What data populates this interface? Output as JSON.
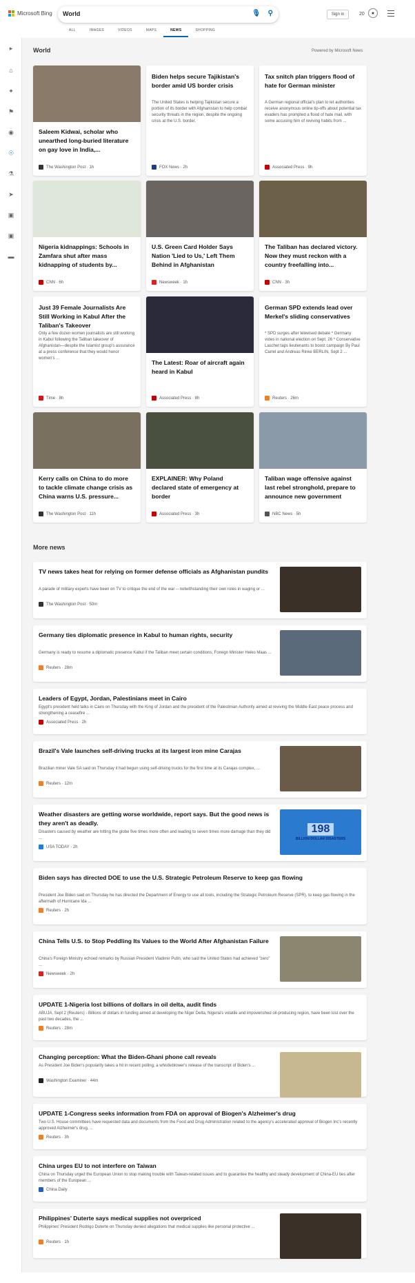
{
  "header": {
    "brand": "Microsoft Bing",
    "query": "World",
    "signin": "Sign in",
    "points": "20"
  },
  "tabs": [
    "ALL",
    "IMAGES",
    "VIDEOS",
    "MAPS",
    "NEWS",
    "SHOPPING"
  ],
  "section": {
    "title": "World",
    "powered": "Powered by Microsoft News"
  },
  "cards": [
    {
      "title": "Saleem Kidwai, scholar who unearthed long-buried literature on gay love in India,...",
      "snippet": "",
      "source": "The Washington Post · 1h",
      "img": true,
      "color": "#8a7a6a"
    },
    {
      "title": "Biden helps secure Tajikistan's border amid US border crisis",
      "snippet": "The United States is helping Tajikistan secure a portion of its border with Afghanistan to help combat security threats in the region, despite the ongoing crisis at the U.S. border.",
      "source": "FOX News · 2h",
      "img": false
    },
    {
      "title": "Tax snitch plan triggers flood of hate for German minister",
      "snippet": "A German regional official's plan to let authorities receive anonymous online tip-offs about potential tax evaders has prompted a flood of hate mail, with some accusing him of reviving habits from ...",
      "source": "Associated Press · 9h",
      "img": false
    },
    {
      "title": "Nigeria kidnappings: Schools in Zamfara shut after mass kidnapping of students by...",
      "snippet": "",
      "source": "CNN · 6h",
      "img": true,
      "color": "#dfe6da"
    },
    {
      "title": "U.S. Green Card Holder Says Nation 'Lied to Us,' Left Them Behind in Afghanistan",
      "snippet": "",
      "source": "Newsweek · 1h",
      "img": true,
      "color": "#6a6560"
    },
    {
      "title": "The Taliban has declared victory. Now they must reckon with a country freefalling into...",
      "snippet": "",
      "source": "CNN · 3h",
      "img": true,
      "color": "#6c6048"
    },
    {
      "title": "Just 39 Female Journalists Are Still Working in Kabul After the Taliban's Takeover",
      "snippet": "Only a few dozen women journalists are still working in Kabul following the Taliban takeover of Afghanistan—despite the Islamist group's assurance at a press conference that they would honor women's ...",
      "source": "Time · 8h",
      "img": false
    },
    {
      "title": "The Latest: Roar of aircraft again heard in Kabul",
      "snippet": "",
      "source": "Associated Press · 8h",
      "img": true,
      "color": "#2a2a3a"
    },
    {
      "title": "German SPD extends lead over Merkel's sliding conservatives",
      "snippet": "* SPD surges after televised debate * Germany votes in national election on Sept. 26 * Conservative Laschet taps lieutenants to boost campaign By Paul Carrel and Andreas Rinke BERLIN, Sept 2 ...",
      "source": "Reuters · 26m",
      "img": false
    },
    {
      "title": "Kerry calls on China to do more to tackle climate change crisis as China warns U.S. pressure...",
      "snippet": "",
      "source": "The Washington Post · 11h",
      "img": true,
      "color": "#7a7060"
    },
    {
      "title": "EXPLAINER: Why Poland declared state of emergency at border",
      "snippet": "",
      "source": "Associated Press · 3h",
      "img": true,
      "color": "#4a5040"
    },
    {
      "title": "Taliban wage offensive against last rebel stronghold, prepare to announce new government",
      "snippet": "",
      "source": "NBC News · 5h",
      "img": true,
      "color": "#8a9aa8"
    }
  ],
  "more_title": "More news",
  "more": [
    {
      "title": "TV news takes heat for relying on former defense officials as Afghanistan pundits",
      "snippet": "A parade of military experts have been on TV to critique the end of the war -- notwithstanding their own roles in waging or ...",
      "source": "The Washington Post · 50m",
      "thumb": "#3a3028"
    },
    {
      "title": "Germany ties diplomatic presence in Kabul to human rights, security",
      "snippet": "Germany is ready to resume a diplomatic presence Kabul if the Taliban meet certain conditions, Foreign Minister Heiko Maas ...",
      "source": "Reuters · 28m",
      "thumb": "#5a6a7a"
    },
    {
      "title": "Leaders of Egypt, Jordan, Palestinians meet in Cairo",
      "snippet": "Egypt's president held talks in Cairo on Thursday with the King of Jordan and the president of the Palestinian Authority aimed at reviving the Middle East peace process and strengthening a ceasefire ...",
      "source": "Associated Press · 2h",
      "thumb": ""
    },
    {
      "title": "Brazil's Vale launches self-driving trucks at its largest iron mine Carajas",
      "snippet": "Brazilian miner Vale SA said on Thursday it had begun using self-driving trucks for the first time at its Carajas complex, ...",
      "source": "Reuters · 12m",
      "thumb": "#6a5a48"
    },
    {
      "title": "Weather disasters are getting worse worldwide, report says. But the good news is they aren't as deadly.",
      "snippet": "Disasters caused by weather are hitting the globe five times more often and leading to seven times more damage than they did ...",
      "source": "USA TODAY · 2h",
      "thumb": "#2a7ad0",
      "badge": "198",
      "badge2": "BILLION DOLLAR DISASTERS"
    },
    {
      "title": "Biden says has directed DOE to use the U.S. Strategic Petroleum Reserve to keep gas flowing",
      "snippet": "President Joe Biden said on Thursday he has directed the Department of Energy to use all tools, including the Strategic Petroleum Reserve (SPR), to keep gas flowing in the aftermath of Hurricane Ida ...",
      "source": "Reuters · 2h",
      "thumb": ""
    },
    {
      "title": "China Tells U.S. to Stop Peddling Its Values to the World After Afghanistan Failure",
      "snippet": "China's Foreign Ministry echoed remarks by Russian President Vladimir Putin, who said the United States had achieved \"zero\" ...",
      "source": "Newsweek · 2h",
      "thumb": "#8a8670"
    },
    {
      "title": "UPDATE 1-Nigeria lost billions of dollars in oil delta, audit finds",
      "snippet": "ABUJA, Sept 2 (Reuters) - Billions of dollars in funding aimed at developing the Niger Delta, Nigeria's volatile and impoverished oil-producing region, have been lost over the past two decades, the ...",
      "source": "Reuters · 28m",
      "thumb": ""
    },
    {
      "title": "Changing perception: What the Biden-Ghani phone call reveals",
      "snippet": "As President Joe Biden's popularity takes a hit in recent polling, a whistleblower's release of the transcript of Biden's ...",
      "source": "Washington Examiner · 44m",
      "thumb": "#c8b890"
    },
    {
      "title": "UPDATE 1-Congress seeks information from FDA on approval of Biogen's Alzheimer's drug",
      "snippet": "Two U.S. House committees have requested data and documents from the Food and Drug Administration related to the agency's accelerated approval of Biogen Inc's recently approved Alzheimer's drug, ...",
      "source": "Reuters · 3h",
      "thumb": ""
    },
    {
      "title": "China urges EU to not interfere on Taiwan",
      "snippet": "China on Thursday urged the European Union to stop making trouble with Taiwan-related issues and to guarantee the healthy and steady development of China-EU ties after members of the European ...",
      "source": "China Daily",
      "thumb": ""
    },
    {
      "title": "Philippines' Duterte says medical supplies not overpriced",
      "snippet": "Philippines' President Rodrigo Duterte on Thursday denied allegations that medical supplies like personal protective ...",
      "source": "Reuters · 1h",
      "thumb": "#3a3028"
    }
  ]
}
